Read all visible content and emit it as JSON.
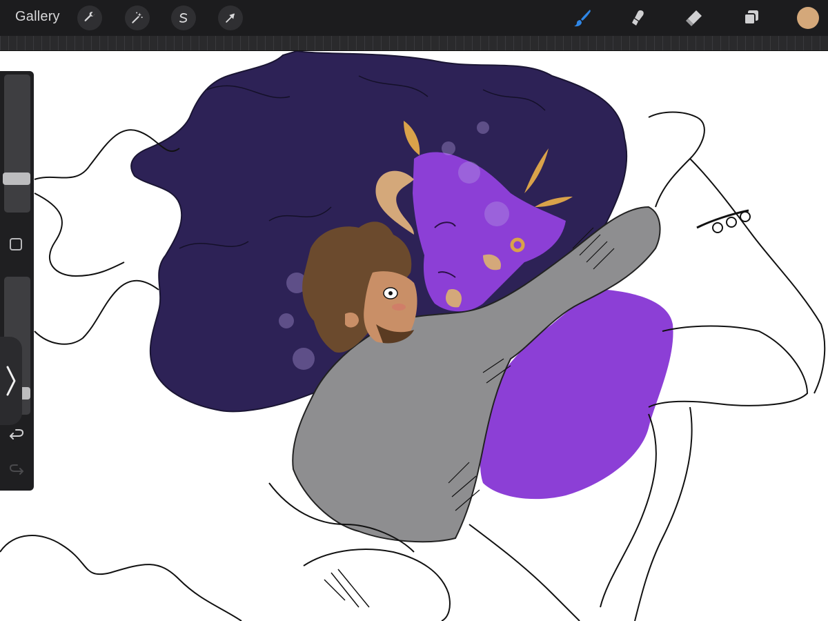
{
  "toolbar": {
    "gallery_label": "Gallery",
    "left_tools": [
      {
        "icon": "wrench-icon",
        "name": "actions"
      },
      {
        "icon": "magic-wand-icon",
        "name": "adjustments"
      },
      {
        "icon": "selection-s-icon",
        "name": "selection"
      },
      {
        "icon": "arrow-cursor-icon",
        "name": "transform"
      }
    ],
    "right_tools": [
      {
        "icon": "brush-icon",
        "name": "paint",
        "active": true
      },
      {
        "icon": "smudge-icon",
        "name": "smudge",
        "active": false
      },
      {
        "icon": "eraser-icon",
        "name": "erase",
        "active": false
      },
      {
        "icon": "layers-icon",
        "name": "layers",
        "active": false
      }
    ],
    "current_color": "#d4a87a"
  },
  "sidebar": {
    "brush_size": 0.22,
    "brush_opacity": 0.12,
    "icons": [
      "modify-square-icon",
      "chevron-right-icon",
      "undo-icon",
      "redo-icon"
    ]
  },
  "colors": {
    "accent": "#2f86e6",
    "hair_dark": "#2d2256",
    "skin_purple": "#8c3fd6",
    "jacket_gray": "#8e8e90",
    "gold": "#d9a24a",
    "brown_hair": "#6b4a2d",
    "skin_tan": "#c98f67"
  }
}
